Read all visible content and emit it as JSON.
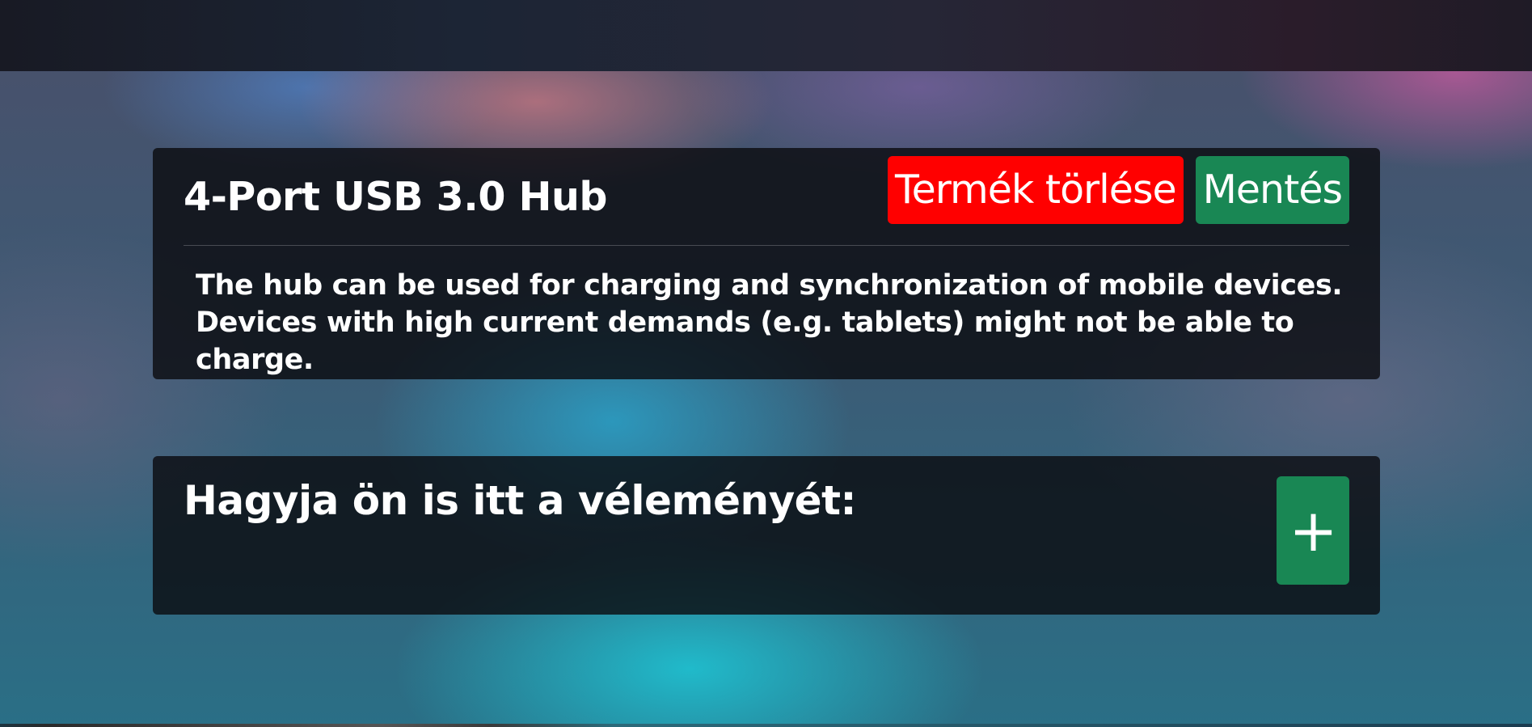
{
  "product": {
    "title": "4-Port USB 3.0 Hub",
    "description": "The hub can be used for charging and synchronization of mobile devices. Devices with high current demands (e.g. tablets) might not be able to charge.",
    "delete_label": "Termék törlése",
    "save_label": "Mentés"
  },
  "review": {
    "title": "Hagyja ön is itt a véleményét:",
    "add_icon": "plus-icon"
  },
  "colors": {
    "delete_button": "#ff0000",
    "save_button": "#198754",
    "add_button": "#198754"
  }
}
